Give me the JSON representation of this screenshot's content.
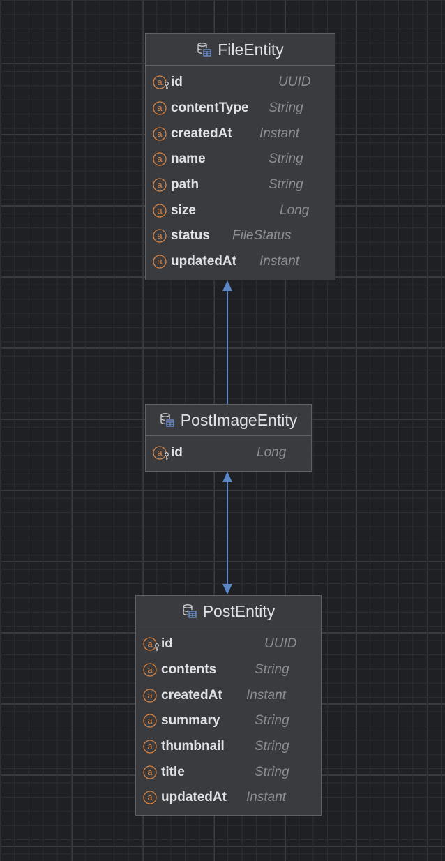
{
  "colors": {
    "background": "#1f2023",
    "box": "#3a3b3e",
    "box_border": "#5f6166",
    "text": "#dfe1e5",
    "type_text": "#8c8e93",
    "field_icon": "#d9823f",
    "connector": "#5b86c7"
  },
  "entities": [
    {
      "name": "FileEntity",
      "icon": "database-table-icon",
      "fields": [
        {
          "name": "id",
          "type": "UUID",
          "icon": "primary-key-field-icon"
        },
        {
          "name": "contentType",
          "type": "String",
          "icon": "field-icon"
        },
        {
          "name": "createdAt",
          "type": "Instant",
          "icon": "field-icon"
        },
        {
          "name": "name",
          "type": "String",
          "icon": "field-icon"
        },
        {
          "name": "path",
          "type": "String",
          "icon": "field-icon"
        },
        {
          "name": "size",
          "type": "Long",
          "icon": "field-icon"
        },
        {
          "name": "status",
          "type": "FileStatus",
          "icon": "field-icon"
        },
        {
          "name": "updatedAt",
          "type": "Instant",
          "icon": "field-icon"
        }
      ]
    },
    {
      "name": "PostImageEntity",
      "icon": "database-table-icon",
      "fields": [
        {
          "name": "id",
          "type": "Long",
          "icon": "primary-key-field-icon"
        }
      ]
    },
    {
      "name": "PostEntity",
      "icon": "database-table-icon",
      "fields": [
        {
          "name": "id",
          "type": "UUID",
          "icon": "primary-key-field-icon"
        },
        {
          "name": "contents",
          "type": "String",
          "icon": "field-icon"
        },
        {
          "name": "createdAt",
          "type": "Instant",
          "icon": "field-icon"
        },
        {
          "name": "summary",
          "type": "String",
          "icon": "field-icon"
        },
        {
          "name": "thumbnail",
          "type": "String",
          "icon": "field-icon"
        },
        {
          "name": "title",
          "type": "String",
          "icon": "field-icon"
        },
        {
          "name": "updatedAt",
          "type": "Instant",
          "icon": "field-icon"
        }
      ]
    }
  ],
  "relations": [
    {
      "from": "PostImageEntity",
      "to": "FileEntity",
      "direction": "to"
    },
    {
      "from": "PostImageEntity",
      "to": "PostEntity",
      "direction": "both"
    }
  ]
}
